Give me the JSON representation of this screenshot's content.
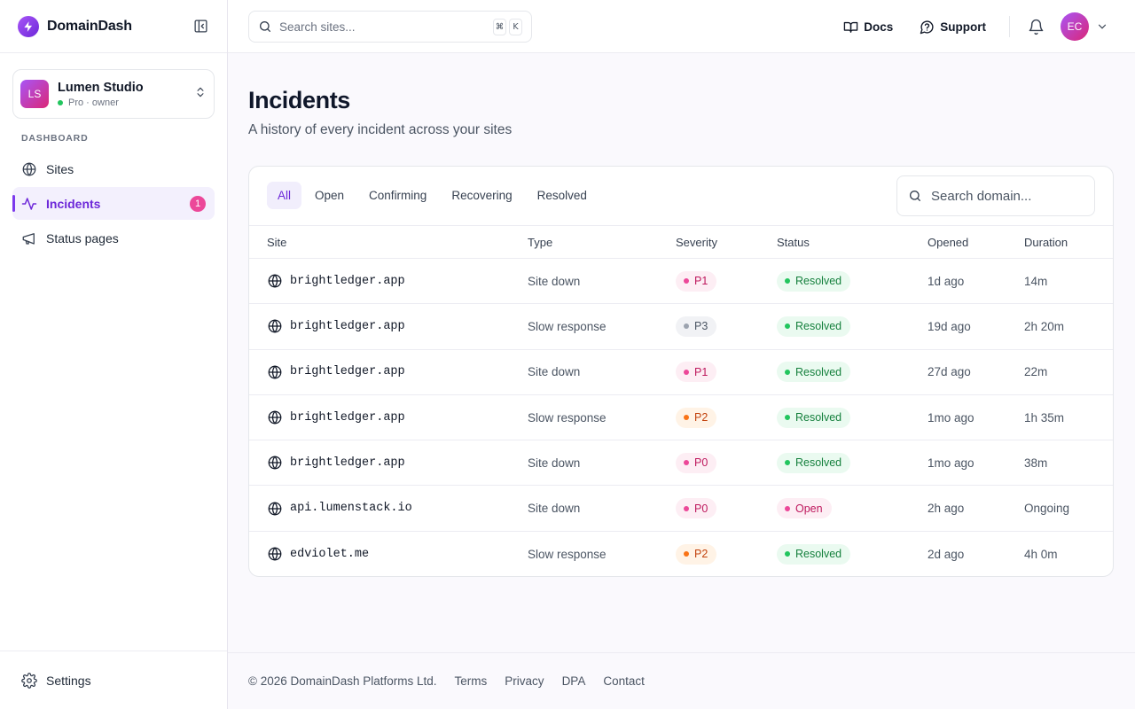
{
  "brand": {
    "name": "DomainDash"
  },
  "workspace": {
    "initials": "LS",
    "name": "Lumen Studio",
    "plan": "Pro · owner"
  },
  "sidebar": {
    "section_label": "DASHBOARD",
    "items": [
      {
        "label": "Sites",
        "icon": "globe-icon"
      },
      {
        "label": "Incidents",
        "icon": "activity-icon",
        "badge": "1",
        "active": true
      },
      {
        "label": "Status pages",
        "icon": "megaphone-icon"
      }
    ],
    "footer": {
      "label": "Settings",
      "icon": "gear-icon"
    }
  },
  "topbar": {
    "search_placeholder": "Search sites...",
    "shortcut": [
      "⌘",
      "K"
    ],
    "docs_label": "Docs",
    "support_label": "Support",
    "user_initials": "EC"
  },
  "page": {
    "title": "Incidents",
    "subtitle": "A history of every incident across your sites"
  },
  "filters": {
    "tabs": [
      "All",
      "Open",
      "Confirming",
      "Recovering",
      "Resolved"
    ],
    "active": "All",
    "search_placeholder": "Search domain..."
  },
  "table": {
    "headers": {
      "site": "Site",
      "type": "Type",
      "severity": "Severity",
      "status": "Status",
      "opened": "Opened",
      "duration": "Duration"
    },
    "rows": [
      {
        "site": "brightledger.app",
        "type": "Site down",
        "severity": "P1",
        "status": "Resolved",
        "opened": "1d ago",
        "duration": "14m"
      },
      {
        "site": "brightledger.app",
        "type": "Slow response",
        "severity": "P3",
        "status": "Resolved",
        "opened": "19d ago",
        "duration": "2h 20m"
      },
      {
        "site": "brightledger.app",
        "type": "Site down",
        "severity": "P1",
        "status": "Resolved",
        "opened": "27d ago",
        "duration": "22m"
      },
      {
        "site": "brightledger.app",
        "type": "Slow response",
        "severity": "P2",
        "status": "Resolved",
        "opened": "1mo ago",
        "duration": "1h 35m"
      },
      {
        "site": "brightledger.app",
        "type": "Site down",
        "severity": "P0",
        "status": "Resolved",
        "opened": "1mo ago",
        "duration": "38m"
      },
      {
        "site": "api.lumenstack.io",
        "type": "Site down",
        "severity": "P0",
        "status": "Open",
        "opened": "2h ago",
        "duration": "Ongoing"
      },
      {
        "site": "edviolet.me",
        "type": "Slow response",
        "severity": "P2",
        "status": "Resolved",
        "opened": "2d ago",
        "duration": "4h 0m"
      }
    ]
  },
  "footer": {
    "copyright": "© 2026 DomainDash Platforms Ltd.",
    "links": [
      "Terms",
      "Privacy",
      "DPA",
      "Contact"
    ]
  },
  "colors": {
    "accent": "#7c3aed",
    "danger": "#ec4899",
    "success": "#22c55e",
    "warning": "#f97316"
  }
}
